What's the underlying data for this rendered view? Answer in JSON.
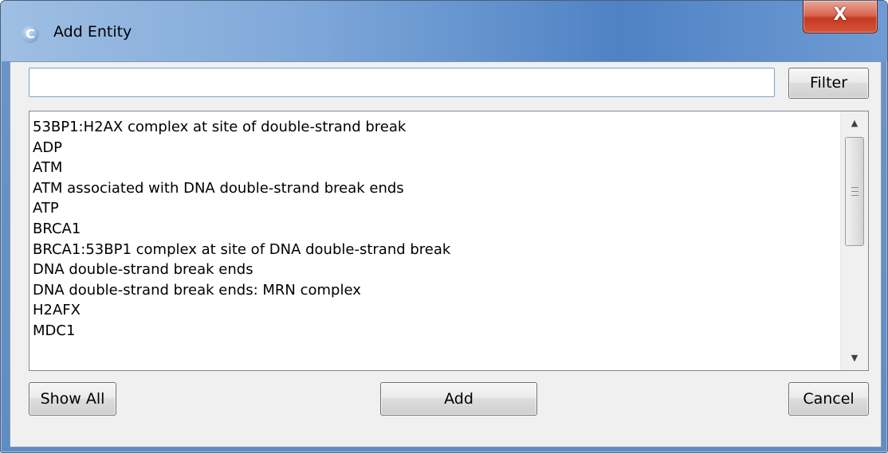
{
  "window": {
    "title": "Add Entity",
    "app_icon_letter": "C",
    "close_glyph": "X",
    "colors": {
      "titlebar": "#6f9bd3",
      "close_button": "#c23a22",
      "client_bg": "#f0f0f0"
    }
  },
  "search": {
    "value": "",
    "placeholder": ""
  },
  "buttons": {
    "filter": "Filter",
    "show_all": "Show All",
    "add": "Add",
    "cancel": "Cancel"
  },
  "list": {
    "items": [
      "53BP1:H2AX complex at site of double-strand break",
      "ADP",
      "ATM",
      "ATM associated with DNA double-strand break ends",
      "ATP",
      "BRCA1",
      "BRCA1:53BP1 complex at site of DNA double-strand break",
      "DNA double-strand break ends",
      "DNA double-strand break ends: MRN complex",
      "H2AFX",
      "MDC1"
    ]
  },
  "scrollbar": {
    "up_icon": "▲",
    "down_icon": "▼"
  }
}
